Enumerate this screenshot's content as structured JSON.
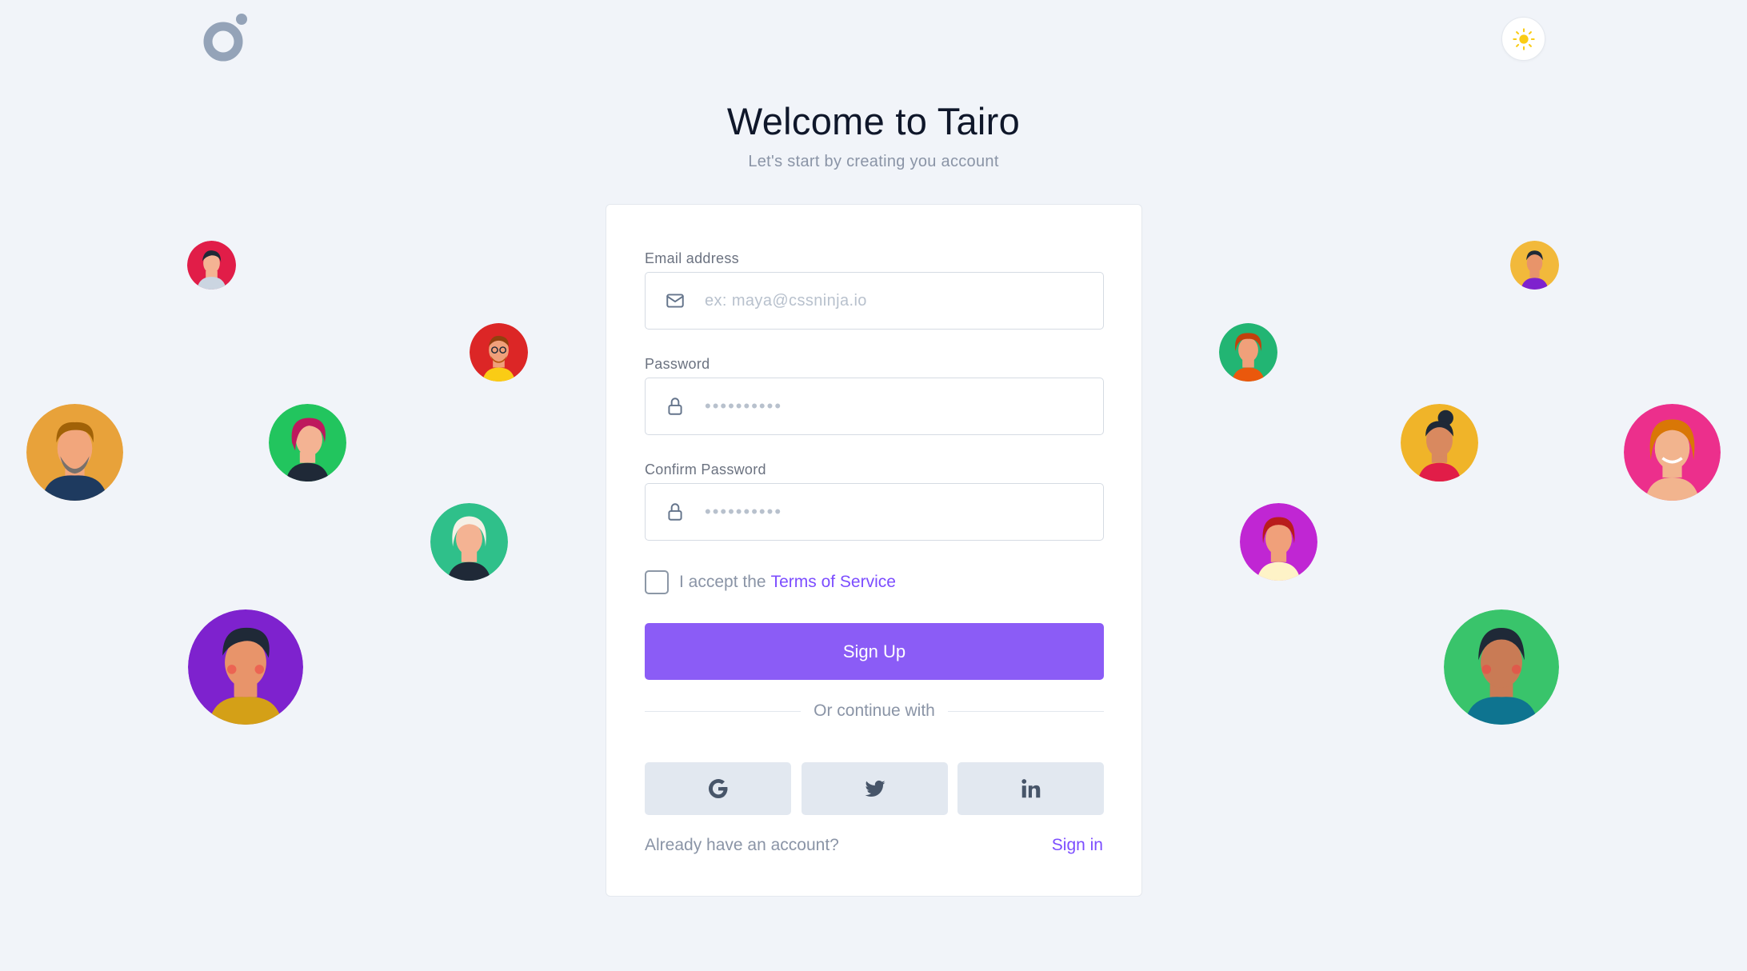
{
  "header": {
    "title": "Welcome to Tairo",
    "subtitle": "Let's start by creating you account"
  },
  "form": {
    "email": {
      "label": "Email address",
      "placeholder": "ex: maya@cssninja.io"
    },
    "password": {
      "label": "Password",
      "placeholder": "••••••••••"
    },
    "confirm_password": {
      "label": "Confirm Password",
      "placeholder": "••••••••••"
    },
    "terms": {
      "prefix": "I accept the",
      "link": "Terms of Service",
      "checked": false
    },
    "submit_label": "Sign Up",
    "divider_text": "Or continue with",
    "social_buttons": [
      {
        "icon": "google-icon"
      },
      {
        "icon": "twitter-icon"
      },
      {
        "icon": "linkedin-icon"
      }
    ],
    "footer": {
      "prompt": "Already have an account?",
      "link": "Sign in"
    }
  },
  "theme_toggle": {
    "icon": "sun-icon"
  },
  "colors": {
    "accent": "#8b5cf6",
    "link": "#7c4dff",
    "background": "#f1f4f9"
  },
  "avatars": [
    {
      "bg": "#e11d48"
    },
    {
      "bg": "#dc2626"
    },
    {
      "bg": "#e8a23a"
    },
    {
      "bg": "#22c55e"
    },
    {
      "bg": "#2fc08a"
    },
    {
      "bg": "#7e22ce"
    },
    {
      "bg": "#f2b93b"
    },
    {
      "bg": "#22b573"
    },
    {
      "bg": "#f0b429"
    },
    {
      "bg": "#ec2f8c"
    },
    {
      "bg": "#c026d3"
    },
    {
      "bg": "#39c46b"
    }
  ]
}
